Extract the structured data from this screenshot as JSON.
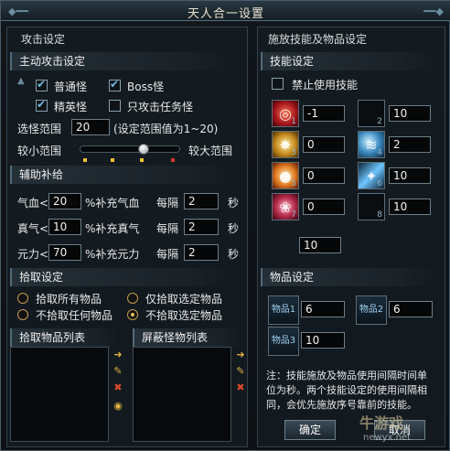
{
  "window": {
    "title": "天人合一设置",
    "close_icon": "close-icon"
  },
  "left": {
    "header": "攻击设定",
    "auto_attack": {
      "title": "主动攻击设定",
      "options": [
        {
          "label": "普通怪",
          "checked": true
        },
        {
          "label": "Boss怪",
          "checked": true
        },
        {
          "label": "精英怪",
          "checked": true
        },
        {
          "label": "只攻击任务怪",
          "checked": false
        }
      ],
      "range_label": "选怪范围",
      "range_value": "20",
      "range_hint": "(设定范围值为1~20)",
      "slider_min_label": "较小范围",
      "slider_max_label": "较大范围",
      "slider_level": 0.65
    },
    "supply": {
      "title": "辅助补给",
      "rows": [
        {
          "label": "气血<",
          "value": "20",
          "desc": "%补充气血",
          "interval_label": "每隔",
          "interval": "2",
          "unit": "秒"
        },
        {
          "label": "真气<",
          "value": "10",
          "desc": "%补充真气",
          "interval_label": "每隔",
          "interval": "2",
          "unit": "秒"
        },
        {
          "label": "元力<",
          "value": "70",
          "desc": "%补充元力",
          "interval_label": "每隔",
          "interval": "2",
          "unit": "秒"
        }
      ]
    },
    "pickup": {
      "title": "拾取设定",
      "options": [
        {
          "label": "拾取所有物品",
          "selected": false
        },
        {
          "label": "仅拾取选定物品",
          "selected": false
        },
        {
          "label": "不拾取任何物品",
          "selected": false
        },
        {
          "label": "不拾取选定物品",
          "selected": true
        }
      ],
      "list1_title": "拾取物品列表",
      "list2_title": "屏蔽怪物列表"
    }
  },
  "right": {
    "header": "施放技能及物品设定",
    "skills": {
      "title": "技能设定",
      "disable_label": "禁止使用技能",
      "disable_checked": false,
      "slots": [
        {
          "num": "1",
          "value": "-1",
          "icon": "icon-red"
        },
        {
          "num": "2",
          "value": "10",
          "icon": ""
        },
        {
          "num": "3",
          "value": "0",
          "icon": "icon-gold"
        },
        {
          "num": "4",
          "value": "2",
          "icon": "icon-blue"
        },
        {
          "num": "5",
          "value": "0",
          "icon": "icon-orange"
        },
        {
          "num": "6",
          "value": "10",
          "icon": "icon-ice"
        },
        {
          "num": "7",
          "value": "0",
          "icon": "icon-rose"
        },
        {
          "num": "8",
          "value": "10",
          "icon": ""
        }
      ],
      "extra_value": "10"
    },
    "items": {
      "title": "物品设定",
      "slots": [
        {
          "label": "物品1",
          "value": "6"
        },
        {
          "label": "物品2",
          "value": "6"
        },
        {
          "label": "物品3",
          "value": "10"
        }
      ]
    },
    "note": "注：技能施放及物品使用间隔时间单位为秒。两个技能设定的使用间隔相同，会优先施放序号靠前的技能。"
  },
  "buttons": {
    "ok": "确定",
    "cancel": "取消"
  },
  "watermark": {
    "site": "newyx.net",
    "brand": "牛游戏"
  }
}
